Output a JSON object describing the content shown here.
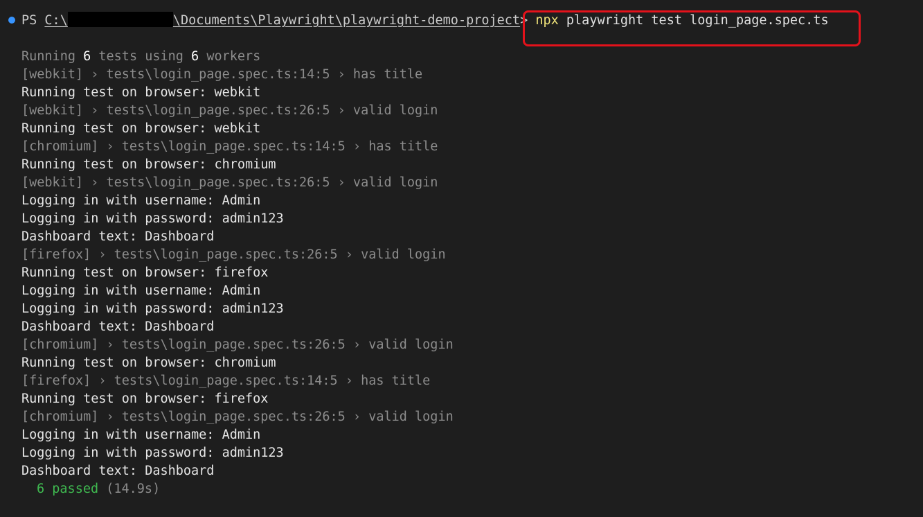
{
  "prompt": {
    "ps": "PS ",
    "path_prefix": "C:\\",
    "path_suffix": "\\Documents\\Playwright\\playwright-demo-project",
    "arrow": ">",
    "cmd_npx": "npx",
    "cmd_rest": " playwright test login_page.spec.ts"
  },
  "summary": {
    "pre": "Running ",
    "count": "6",
    "mid": " tests using ",
    "workers": "6",
    "post": " workers"
  },
  "lines": [
    {
      "text": "[webkit] › tests\\login_page.spec.ts:14:5 › has title",
      "style": "dim"
    },
    {
      "text": "Running test on browser: webkit",
      "style": "white"
    },
    {
      "text": "[webkit] › tests\\login_page.spec.ts:26:5 › valid login",
      "style": "dim"
    },
    {
      "text": "Running test on browser: webkit",
      "style": "white"
    },
    {
      "text": "[chromium] › tests\\login_page.spec.ts:14:5 › has title",
      "style": "dim"
    },
    {
      "text": "Running test on browser: chromium",
      "style": "white"
    },
    {
      "text": "[webkit] › tests\\login_page.spec.ts:26:5 › valid login",
      "style": "dim"
    },
    {
      "text": "Logging in with username: Admin",
      "style": "white"
    },
    {
      "text": "Logging in with password: admin123",
      "style": "white"
    },
    {
      "text": "Dashboard text: Dashboard",
      "style": "white"
    },
    {
      "text": "[firefox] › tests\\login_page.spec.ts:26:5 › valid login",
      "style": "dim"
    },
    {
      "text": "Running test on browser: firefox",
      "style": "white"
    },
    {
      "text": "Logging in with username: Admin",
      "style": "white"
    },
    {
      "text": "Logging in with password: admin123",
      "style": "white"
    },
    {
      "text": "Dashboard text: Dashboard",
      "style": "white"
    },
    {
      "text": "[chromium] › tests\\login_page.spec.ts:26:5 › valid login",
      "style": "dim"
    },
    {
      "text": "Running test on browser: chromium",
      "style": "white"
    },
    {
      "text": "[firefox] › tests\\login_page.spec.ts:14:5 › has title",
      "style": "dim"
    },
    {
      "text": "Running test on browser: firefox",
      "style": "white"
    },
    {
      "text": "[chromium] › tests\\login_page.spec.ts:26:5 › valid login",
      "style": "dim"
    },
    {
      "text": "Logging in with username: Admin",
      "style": "white"
    },
    {
      "text": "Logging in with password: admin123",
      "style": "white"
    },
    {
      "text": "Dashboard text: Dashboard",
      "style": "white"
    }
  ],
  "result": {
    "passed": "6 passed",
    "time": " (14.9s)"
  },
  "colors": {
    "background": "#1e1e1e",
    "highlight_border": "#e3121b",
    "passed": "#3fb950",
    "npx": "#f0e47a",
    "status_dot": "#3794ff"
  }
}
